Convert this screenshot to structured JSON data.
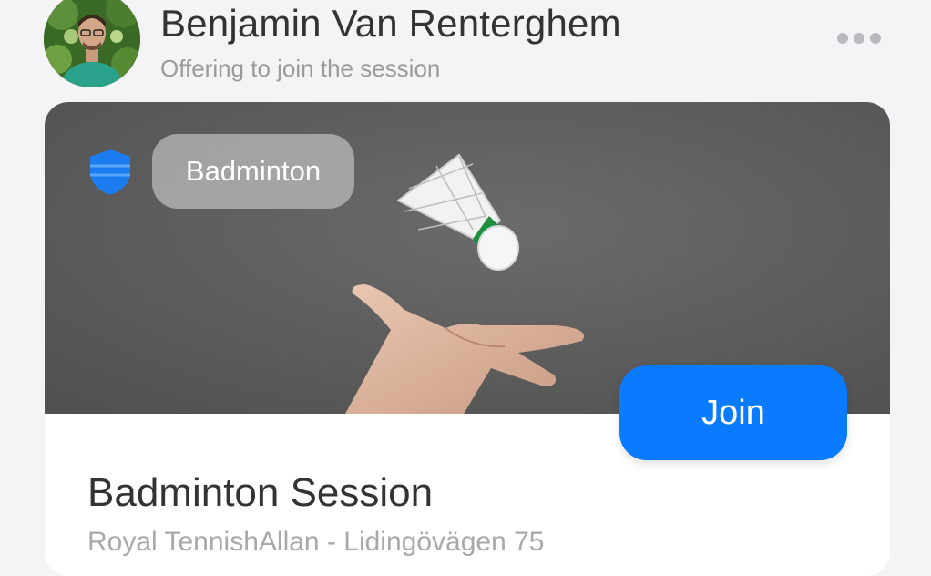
{
  "header": {
    "user_name": "Benjamin Van Renterghem",
    "status": "Offering to join the session",
    "avatar_icon": "user-avatar-photo",
    "more_icon": "ellipsis-horizontal-icon"
  },
  "card": {
    "sport_label": "Badminton",
    "sport_icon": "shield-icon",
    "join_label": "Join",
    "session_title": "Badminton Session",
    "location": "Royal TennishAllan - Lidingövägen 75",
    "colors": {
      "accent": "#0a7bff",
      "hero_bg": "#5e5f5e",
      "pill_bg": "#bebebe"
    }
  }
}
